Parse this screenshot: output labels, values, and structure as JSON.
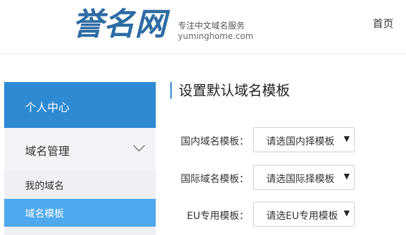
{
  "header": {
    "logo_text": "誉名网",
    "tagline": "专注中文域名服务",
    "domain": "yuminghome.com",
    "home_link": "首页"
  },
  "sidebar": {
    "title": "个人中心",
    "section": {
      "label": "域名管理",
      "chevron": "chevron-down-icon",
      "items": [
        {
          "label": "我的域名",
          "active": false
        },
        {
          "label": "域名模板",
          "active": true
        }
      ]
    }
  },
  "main": {
    "title": "设置默认域名模板",
    "rows": [
      {
        "label": "国内域名模板：",
        "selected": "请选国内择模板"
      },
      {
        "label": "国际域名模板：",
        "selected": "请选国际择模板"
      },
      {
        "label": "EU专用模板：",
        "selected": "请选EU专用模板"
      }
    ]
  },
  "colors": {
    "brand": "#2e6ca4",
    "accent": "#2e8ad3",
    "active_item": "#4fa9ee"
  }
}
